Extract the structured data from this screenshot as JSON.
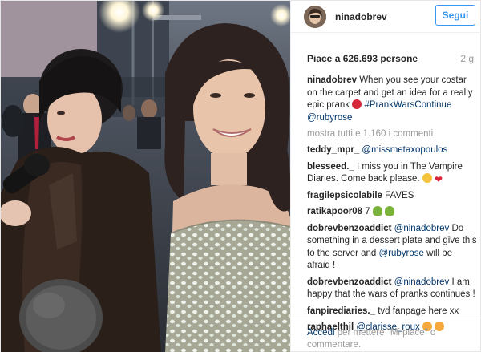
{
  "post": {
    "username": "ninadobrev",
    "follow_label": "Segui",
    "likes": "Piace a 626.693 persone",
    "time": "2 g",
    "caption": {
      "user": "ninadobrev",
      "text": "When you see your costar on the carpet and get an idea for a really epic prank",
      "hashtag": "#PrankWarsContinue",
      "mention": "@rubyrose"
    },
    "show_all": "mostra tutti e 1.160 i commenti",
    "comments": [
      {
        "user": "teddy_mpr_",
        "mention": "@missmetaxopoulos",
        "text": ""
      },
      {
        "user": "blesseed._",
        "text": "I miss you in The Vampire Diaries. Come back please."
      },
      {
        "user": "fragilepsicolabile",
        "text": "FAVES"
      },
      {
        "user": "ratikapoor08",
        "text": "7"
      },
      {
        "user": "dobrevbenzoaddict",
        "mention": "@ninadobrev",
        "text": "Do something in a dessert plate and give this to the server and",
        "mention2": "@rubyrose",
        "text2": "will be afraid !"
      },
      {
        "user": "dobrevbenzoaddict",
        "mention": "@ninadobrev",
        "text": "I am happy that the wars of pranks continues !"
      },
      {
        "user": "fanpirediaries._",
        "text": "tvd fanpage here xx"
      },
      {
        "user": "raphaelthil",
        "mention": "@clarisse_roux",
        "text": ""
      }
    ],
    "footer": {
      "login": "Accedi",
      "rest": "per mettere \"Mi piace\" o commentare."
    }
  },
  "icons": {
    "devil": "smiling-face-with-horns-icon",
    "heart": "red-heart-icon",
    "tree": "tree-icon",
    "heart_eyes": "heart-eyes-icon"
  },
  "colors": {
    "link": "#003569",
    "follow": "#3897f0",
    "muted": "#999999",
    "text": "#262626"
  }
}
